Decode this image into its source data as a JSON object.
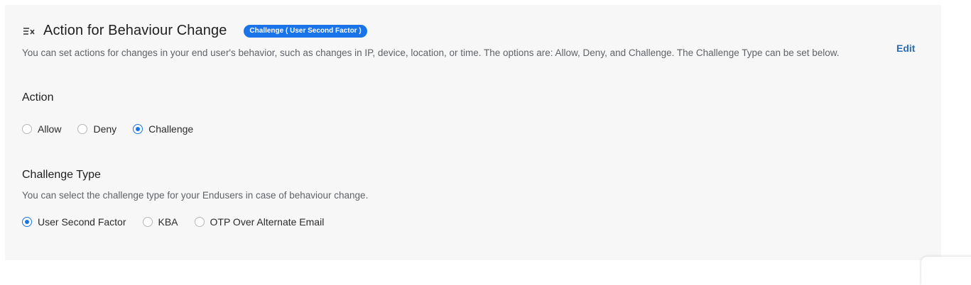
{
  "section": {
    "title": "Action for Behaviour Change",
    "badge": "Challenge ( User Second Factor )",
    "description": "You can set actions for changes in your end user's behavior, such as changes in IP, device, location, or time. The options are: Allow, Deny, and Challenge. The Challenge Type can be set below.",
    "edit_label": "Edit",
    "header_icon": "filter-x-icon"
  },
  "action": {
    "heading": "Action",
    "options": [
      {
        "label": "Allow",
        "selected": false
      },
      {
        "label": "Deny",
        "selected": false
      },
      {
        "label": "Challenge",
        "selected": true
      }
    ]
  },
  "challenge_type": {
    "heading": "Challenge Type",
    "description": "You can select the challenge type for your Endusers in case of behaviour change.",
    "options": [
      {
        "label": "User Second Factor",
        "selected": true
      },
      {
        "label": "KBA",
        "selected": false
      },
      {
        "label": "OTP Over Alternate Email",
        "selected": false
      }
    ]
  },
  "colors": {
    "accent": "#1a73e8",
    "card_background": "#f7f7f7",
    "edit_link": "#2b6cb0"
  }
}
